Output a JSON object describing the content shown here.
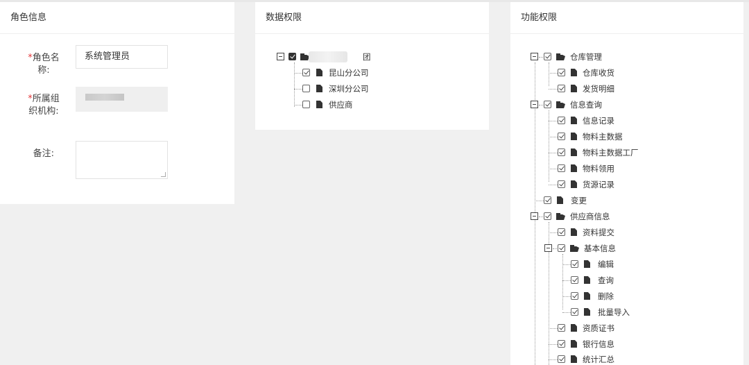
{
  "panels": {
    "role_info": {
      "title": "角色信息"
    },
    "data_permission": {
      "title": "数据权限"
    },
    "func_permission": {
      "title": "功能权限"
    }
  },
  "role_form": {
    "name_label": "角色名称:",
    "name_value": "系统管理员",
    "org_label": "所属组织机构:",
    "remark_label": "备注:",
    "required_mark": "*"
  },
  "data_tree": {
    "root_suffix": "团",
    "children": [
      "昆山分公司",
      "深圳分公司",
      "供应商"
    ]
  },
  "func_tree": {
    "warehouse": "仓库管理",
    "warehouse_children": [
      "仓库收货",
      "发货明细"
    ],
    "info_query": "信息查询",
    "info_query_children": [
      "信息记录",
      "物料主数据",
      "物料主数据工厂",
      "物料领用",
      "货源记录"
    ],
    "change": "变更",
    "supplier_info": "供应商信息",
    "submit": "资料提交",
    "basic_info": "基本信息",
    "basic_children": [
      "编辑",
      "查询",
      "删除",
      "批量导入"
    ],
    "supplier_children": [
      "资质证书",
      "银行信息",
      "统计汇总"
    ]
  }
}
